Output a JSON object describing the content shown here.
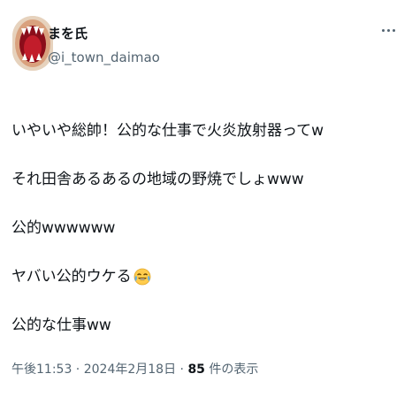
{
  "author": {
    "display_name": "まを氏",
    "handle": "@i_town_daimao",
    "avatar_icon": "open-mouth-monster-avatar"
  },
  "menu": {
    "more_icon": "more-options-icon"
  },
  "tweet": {
    "lines": [
      "いやいや総帥！公的な仕事で火炎放射器ってw",
      "それ田舎あるあるの地域の野焼でしょwww",
      "公的wwwwww",
      "ヤバい公的ウケる",
      "公的な仕事ww"
    ],
    "emoji": "face-with-tears-of-joy"
  },
  "meta": {
    "time": "午後11:53",
    "separator": " · ",
    "date": "2024年2月18日",
    "separator2": " · ",
    "view_count": "85",
    "view_label": " 件の表示"
  },
  "colors": {
    "text": "#0f1419",
    "secondary": "#536471",
    "background": "#ffffff"
  }
}
